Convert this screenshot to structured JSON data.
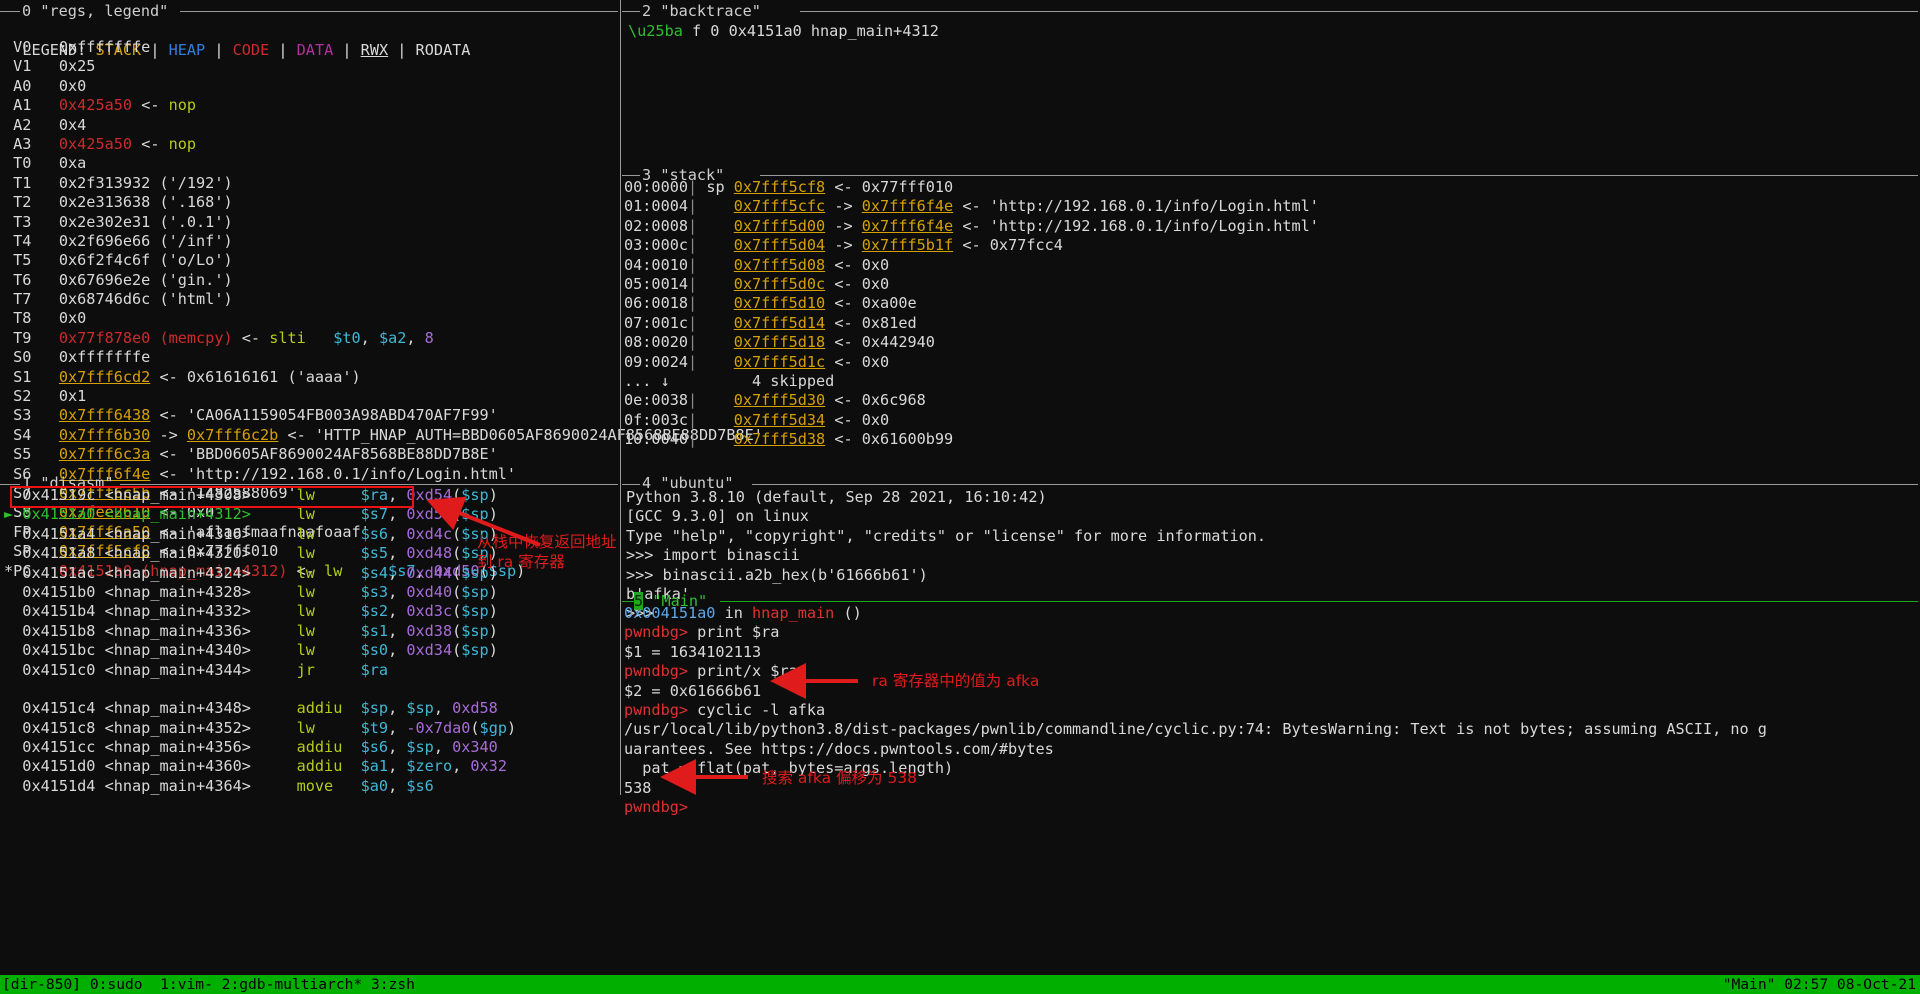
{
  "panels": {
    "regs": {
      "num": "0",
      "title": "\"regs, legend\""
    },
    "disasm": {
      "num": "1",
      "title": "\"disasm\""
    },
    "backtrace": {
      "num": "2",
      "title": "\"backtrace\""
    },
    "stack": {
      "num": "3",
      "title": "\"stack\""
    },
    "ubuntu": {
      "num": "4",
      "title": "\"ubuntu\""
    },
    "main": {
      "num": "5",
      "title": "\"Main\""
    }
  },
  "legend": {
    "prefix": "LEGEND:",
    "items": [
      "STACK",
      "HEAP",
      "CODE",
      "DATA",
      "RWX",
      "RODATA"
    ],
    "sep": "|"
  },
  "registers": [
    {
      "name": "V0",
      "text": "0xfffffffe"
    },
    {
      "name": "V1",
      "text": "0x25"
    },
    {
      "name": "A0",
      "text": "0x0"
    },
    {
      "name": "A1",
      "text": "0x425a50 <- nop"
    },
    {
      "name": "A2",
      "text": "0x4"
    },
    {
      "name": "A3",
      "text": "0x425a50 <- nop"
    },
    {
      "name": "T0",
      "text": "0xa"
    },
    {
      "name": "T1",
      "text": "0x2f313932 ('/192')"
    },
    {
      "name": "T2",
      "text": "0x2e313638 ('.168')"
    },
    {
      "name": "T3",
      "text": "0x2e302e31 ('.0.1')"
    },
    {
      "name": "T4",
      "text": "0x2f696e66 ('/inf')"
    },
    {
      "name": "T5",
      "text": "0x6f2f4c6f ('o/Lo')"
    },
    {
      "name": "T6",
      "text": "0x67696e2e ('gin.')"
    },
    {
      "name": "T7",
      "text": "0x68746d6c ('html')"
    },
    {
      "name": "T8",
      "text": "0x0"
    },
    {
      "name": "T9",
      "text": "0x77f878e0 (memcpy) <- slti   $t0, $a2, 8"
    },
    {
      "name": "S0",
      "text": "0xfffffffe"
    },
    {
      "name": "S1",
      "text": "0x7fff6cd2 <- 0x61616161 ('aaaa')"
    },
    {
      "name": "S2",
      "text": "0x1"
    },
    {
      "name": "S3",
      "text": "0x7fff6438 <- 'CA06A1159054FB003A98ABD470AF7F99'"
    },
    {
      "name": "S4",
      "text": "0x7fff6b30 -> 0x7fff6c2b <- 'HTTP_HNAP_AUTH=BBD0605AF8690024AF8568BE88DD7B8E'"
    },
    {
      "name": "S5",
      "text": "0x7fff6c3a <- 'BBD0605AF8690024AF8568BE88DD7B8E'"
    },
    {
      "name": "S6",
      "text": "0x7fff6f4e <- 'http://192.168.0.1/info/Login.html'"
    },
    {
      "name": "S7",
      "text": "0x7fff6c5b <- '1482588069'"
    },
    {
      "name": "S8",
      "text": "0x7fee2610 <- 0x0"
    },
    {
      "name": "FP",
      "text": "0x7fff6a50 <- 'aflaafmaafnaafoaaf'"
    },
    {
      "name": "SP",
      "text": "0x7fff5cf8 <- 0x77fff010"
    },
    {
      "name": "*PC",
      "text": "0x4151a0 (hnap_main+4312) <- lw     $s7, 0xd50($sp)"
    }
  ],
  "reg_values": {
    "v0": "0xfffffffe",
    "v1": "0x25",
    "a0": "0x0",
    "a1_addr": "0x425a50",
    "a1_arrow": "<-",
    "a1_insn": "nop",
    "a2": "0x4",
    "a3_addr": "0x425a50",
    "a3_arrow": "<-",
    "a3_insn": "nop",
    "t0": "0xa",
    "t1": "0x2f313932 ('/192')",
    "t2": "0x2e313638 ('.168')",
    "t3": "0x2e302e31 ('.0.1')",
    "t4": "0x2f696e66 ('/inf')",
    "t5": "0x6f2f4c6f ('o/Lo')",
    "t6": "0x67696e2e ('gin.')",
    "t7": "0x68746d6c ('html')",
    "t8": "0x0",
    "t9_addr": "0x77f878e0 (memcpy)",
    "t9_op": "slti",
    "t9_args_a": "$t0",
    "t9_args_b": "$a2",
    "t9_imm": "8",
    "s0": "0xfffffffe",
    "s1_addr": "0x7fff6cd2",
    "s1_val": "0x61616161 ('aaaa')",
    "s2": "0x1",
    "s3_addr": "0x7fff6438",
    "s3_val": "'CA06A1159054FB003A98ABD470AF7F99'",
    "s4_addr": "0x7fff6b30",
    "s4_addr2": "0x7fff6c2b",
    "s4_val": "'HTTP_HNAP_AUTH=BBD0605AF8690024AF8568BE88DD7B8E'",
    "s5_addr": "0x7fff6c3a",
    "s5_val": "'BBD0605AF8690024AF8568BE88DD7B8E'",
    "s6_addr": "0x7fff6f4e",
    "s6_val": "'http://192.168.0.1/info/Login.html'",
    "s7_addr": "0x7fff6c5b",
    "s7_val": "'1482588069'",
    "s8_addr": "0x7fee2610",
    "s8_val": "0x0",
    "fp_addr": "0x7fff6a50",
    "fp_val": "'aflaafmaafnaafoaaf'",
    "sp_addr": "0x7fff5cf8",
    "sp_val": "0x77fff010",
    "pc_addr": "0x4151a0 (hnap_main+4312)",
    "pc_op": "lw",
    "pc_reg": "$s7",
    "pc_off": "0xd50",
    "pc_base": "$sp"
  },
  "disasm": [
    {
      "marker": "",
      "addr": "0x41519c",
      "sym": "<hnap_main+4308>",
      "op": "lw",
      "args": "$ra, 0xd54($sp)",
      "reg": "$ra",
      "off": "0xd54",
      "base": "$sp",
      "current": false,
      "boxed": true
    },
    {
      "marker": "►",
      "addr": "0x4151a0",
      "sym": "<hnap_main+4312>",
      "op": "lw",
      "args": "$s7, 0xd50($sp)",
      "reg": "$s7",
      "off": "0xd50",
      "base": "$sp",
      "current": true,
      "boxed": false
    },
    {
      "marker": "",
      "addr": "0x4151a4",
      "sym": "<hnap_main+4316>",
      "op": "lw",
      "args": "$s6, 0xd4c($sp)",
      "reg": "$s6",
      "off": "0xd4c",
      "base": "$sp",
      "current": false,
      "boxed": false
    },
    {
      "marker": "",
      "addr": "0x4151a8",
      "sym": "<hnap_main+4320>",
      "op": "lw",
      "args": "$s5, 0xd48($sp)",
      "reg": "$s5",
      "off": "0xd48",
      "base": "$sp",
      "current": false,
      "boxed": false
    },
    {
      "marker": "",
      "addr": "0x4151ac",
      "sym": "<hnap_main+4324>",
      "op": "lw",
      "args": "$s4, 0xd44($sp)",
      "reg": "$s4",
      "off": "0xd44",
      "base": "$sp",
      "current": false,
      "boxed": false
    },
    {
      "marker": "",
      "addr": "0x4151b0",
      "sym": "<hnap_main+4328>",
      "op": "lw",
      "args": "$s3, 0xd40($sp)",
      "reg": "$s3",
      "off": "0xd40",
      "base": "$sp",
      "current": false,
      "boxed": false
    },
    {
      "marker": "",
      "addr": "0x4151b4",
      "sym": "<hnap_main+4332>",
      "op": "lw",
      "args": "$s2, 0xd3c($sp)",
      "reg": "$s2",
      "off": "0xd3c",
      "base": "$sp",
      "current": false,
      "boxed": false
    },
    {
      "marker": "",
      "addr": "0x4151b8",
      "sym": "<hnap_main+4336>",
      "op": "lw",
      "args": "$s1, 0xd38($sp)",
      "reg": "$s1",
      "off": "0xd38",
      "base": "$sp",
      "current": false,
      "boxed": false
    },
    {
      "marker": "",
      "addr": "0x4151bc",
      "sym": "<hnap_main+4340>",
      "op": "lw",
      "args": "$s0, 0xd34($sp)",
      "reg": "$s0",
      "off": "0xd34",
      "base": "$sp",
      "current": false,
      "boxed": false
    },
    {
      "marker": "",
      "addr": "0x4151c0",
      "sym": "<hnap_main+4344>",
      "op": "jr",
      "args": "$ra",
      "reg": "$ra",
      "off": "",
      "base": "",
      "current": false,
      "boxed": false
    },
    {
      "marker": "",
      "addr": "",
      "sym": "",
      "op": "",
      "args": "",
      "reg": "",
      "off": "",
      "base": "",
      "current": false,
      "boxed": false
    },
    {
      "marker": "",
      "addr": "0x4151c4",
      "sym": "<hnap_main+4348>",
      "op": "addiu",
      "args": "$sp, $sp, 0xd58",
      "reg": "$sp",
      "off": "0xd58",
      "base": "$sp",
      "current": false,
      "boxed": false
    },
    {
      "marker": "",
      "addr": "0x4151c8",
      "sym": "<hnap_main+4352>",
      "op": "lw",
      "args": "$t9, -0x7da0($gp)",
      "reg": "$t9",
      "off": "-0x7da0",
      "base": "$gp",
      "current": false,
      "boxed": false
    },
    {
      "marker": "",
      "addr": "0x4151cc",
      "sym": "<hnap_main+4356>",
      "op": "addiu",
      "args": "$s6, $sp, 0x340",
      "reg": "$s6",
      "off": "0x340",
      "base": "$sp",
      "current": false,
      "boxed": false
    },
    {
      "marker": "",
      "addr": "0x4151d0",
      "sym": "<hnap_main+4360>",
      "op": "addiu",
      "args": "$a1, $zero, 0x32",
      "reg": "$a1",
      "off": "0x32",
      "base": "$zero",
      "current": false,
      "boxed": false
    },
    {
      "marker": "",
      "addr": "0x4151d4",
      "sym": "<hnap_main+4364>",
      "op": "move",
      "args": "$a0, $s6",
      "reg": "$a0",
      "off": "",
      "base": "$s6",
      "current": false,
      "boxed": false
    }
  ],
  "backtrace": [
    {
      "marker": "►",
      "text": "f 0 0x4151a0 hnap_main+4312"
    }
  ],
  "stack": [
    {
      "idx": "00:0000",
      "sp": "sp",
      "addr": "0x7fff5cf8",
      "arrow1": "<-",
      "mid": "",
      "arrow2": "",
      "val": "0x77fff010"
    },
    {
      "idx": "01:0004",
      "sp": "",
      "addr": "0x7fff5cfc",
      "arrow1": "->",
      "mid": "0x7fff6f4e",
      "arrow2": "<-",
      "val": "'http://192.168.0.1/info/Login.html'"
    },
    {
      "idx": "02:0008",
      "sp": "",
      "addr": "0x7fff5d00",
      "arrow1": "->",
      "mid": "0x7fff6f4e",
      "arrow2": "<-",
      "val": "'http://192.168.0.1/info/Login.html'"
    },
    {
      "idx": "03:000c",
      "sp": "",
      "addr": "0x7fff5d04",
      "arrow1": "->",
      "mid": "0x7fff5b1f",
      "arrow2": "<-",
      "val": "0x77fcc4"
    },
    {
      "idx": "04:0010",
      "sp": "",
      "addr": "0x7fff5d08",
      "arrow1": "<-",
      "mid": "",
      "arrow2": "",
      "val": "0x0"
    },
    {
      "idx": "05:0014",
      "sp": "",
      "addr": "0x7fff5d0c",
      "arrow1": "<-",
      "mid": "",
      "arrow2": "",
      "val": "0x0"
    },
    {
      "idx": "06:0018",
      "sp": "",
      "addr": "0x7fff5d10",
      "arrow1": "<-",
      "mid": "",
      "arrow2": "",
      "val": "0xa00e"
    },
    {
      "idx": "07:001c",
      "sp": "",
      "addr": "0x7fff5d14",
      "arrow1": "<-",
      "mid": "",
      "arrow2": "",
      "val": "0x81ed"
    },
    {
      "idx": "08:0020",
      "sp": "",
      "addr": "0x7fff5d18",
      "arrow1": "<-",
      "mid": "",
      "arrow2": "",
      "val": "0x442940"
    },
    {
      "idx": "09:0024",
      "sp": "",
      "addr": "0x7fff5d1c",
      "arrow1": "<-",
      "mid": "",
      "arrow2": "",
      "val": "0x0"
    },
    {
      "idx": "... ↓",
      "sp": "",
      "addr": "",
      "arrow1": "",
      "mid": "",
      "arrow2": "",
      "val": "4 skipped",
      "skipped": true
    },
    {
      "idx": "0e:0038",
      "sp": "",
      "addr": "0x7fff5d30",
      "arrow1": "<-",
      "mid": "",
      "arrow2": "",
      "val": "0x6c968"
    },
    {
      "idx": "0f:003c",
      "sp": "",
      "addr": "0x7fff5d34",
      "arrow1": "<-",
      "mid": "",
      "arrow2": "",
      "val": "0x0"
    },
    {
      "idx": "10:0040",
      "sp": "",
      "addr": "0x7fff5d38",
      "arrow1": "<-",
      "mid": "",
      "arrow2": "",
      "val": "0x61600b99"
    }
  ],
  "ubuntu_terminal": [
    "Python 3.8.10 (default, Sep 28 2021, 16:10:42)",
    "[GCC 9.3.0] on linux",
    "Type \"help\", \"copyright\", \"credits\" or \"license\" for more information.",
    ">>> import binascii",
    ">>> binascii.a2b_hex(b'61666b61')",
    "b'afka'",
    ">>>"
  ],
  "main_terminal": {
    "location_addr": "0x004151a0",
    "location_in": "in",
    "location_fn": "hnap_main",
    "location_paren": "()",
    "prompt": "pwndbg>",
    "lines": [
      {
        "prompt": "pwndbg>",
        "cmd": "print $ra"
      },
      {
        "out": "$1 = 1634102113"
      },
      {
        "prompt": "pwndbg>",
        "cmd": "print/x $ra"
      },
      {
        "out": "$2 = 0x61666b61"
      },
      {
        "prompt": "pwndbg>",
        "cmd": "cyclic -l afka"
      },
      {
        "out": "/usr/local/lib/python3.8/dist-packages/pwnlib/commandline/cyclic.py:74: BytesWarning: Text is not bytes; assuming ASCII, no g"
      },
      {
        "out": "uarantees. See https://docs.pwntools.com/#bytes"
      },
      {
        "out": "  pat = flat(pat, bytes=args.length)"
      },
      {
        "out": "538"
      },
      {
        "prompt": "pwndbg>",
        "cmd": ""
      }
    ]
  },
  "annotations": [
    {
      "text": "从栈中恢复返回地址",
      "id": "anno-restore-ra-1"
    },
    {
      "text": "到 ra 寄存器",
      "id": "anno-restore-ra-2"
    },
    {
      "text": "ra 寄存器中的值为 afka",
      "id": "anno-ra-value"
    },
    {
      "text": "搜索 afka 偏移为 538",
      "id": "anno-offset"
    }
  ],
  "statusbar": {
    "left": "[dir-850] 0:sudo  1:vim- 2:gdb-multiarch* 3:zsh",
    "right": "\"Main\" 02:57 08-Oct-21"
  },
  "colors": {
    "stack": "#d6a000",
    "heap": "#2f7fdb",
    "code": "#cc2b2b",
    "data": "#b0309f",
    "rwx": "#d9d9d9",
    "rodata": "#d9d9d9",
    "highlight_box": "#ee1111",
    "annotation": "#e01b1b",
    "statusbar_bg": "#00af00",
    "main_rule": "#1ea81e"
  }
}
